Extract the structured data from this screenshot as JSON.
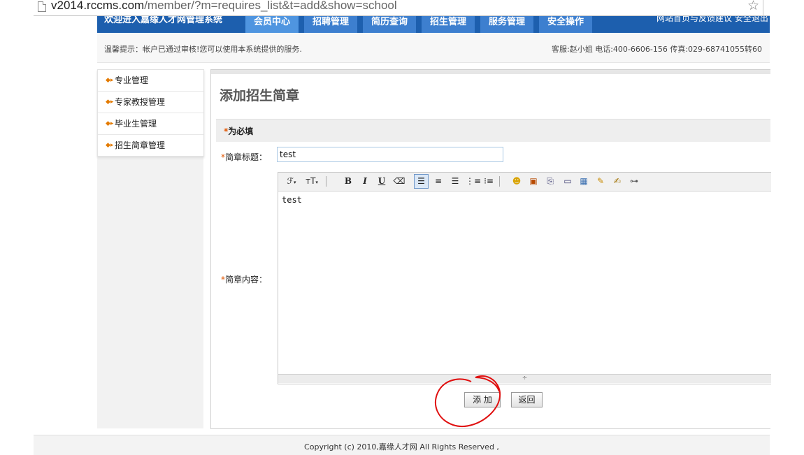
{
  "address_bar": {
    "url_host": "v2014.rccms.com",
    "url_path": "/member/?m=requires_list&t=add&show=school",
    "page_icon": "page-icon",
    "bookmark_icon": "star-icon"
  },
  "nav": {
    "welcome": "欢迎进入嘉缘人才网管理系统",
    "tabs": [
      "会员中心",
      "招聘管理",
      "简历查询",
      "招生管理",
      "服务管理",
      "安全操作"
    ],
    "top_right": "网站首页与反馈建议 安全退出"
  },
  "tip_bar": {
    "tip": "温馨提示：帐户已通过审核!您可以使用本系统提供的服务.",
    "contact": "客服:赵小姐 电话:400-6606-156 传真:029-68741055转60"
  },
  "sidebar": {
    "items": [
      "专业管理",
      "专家教授管理",
      "毕业生管理",
      "招生简章管理"
    ]
  },
  "form": {
    "page_title": "添加招生简章",
    "required_star": "*",
    "required_note": "为必填",
    "title_label": "简章标题：",
    "title_value": "test",
    "content_label": "简章内容：",
    "content_value": "test",
    "submit_label": "添 加",
    "back_label": "返回"
  },
  "editor_toolbar": {
    "font_family_icon": "ℱ",
    "font_size_icon": "ᴛT",
    "bold": "B",
    "italic": "I",
    "underline": "U"
  },
  "footer": {
    "copyright": "Copyright (c) 2010,嘉缘人才网 All Rights Reserved ,"
  },
  "colors": {
    "nav_bg": "#1d5fae",
    "tab_bg": "#3d7fcf",
    "required_star": "#e25500",
    "annotation_circle": "#e01010"
  }
}
